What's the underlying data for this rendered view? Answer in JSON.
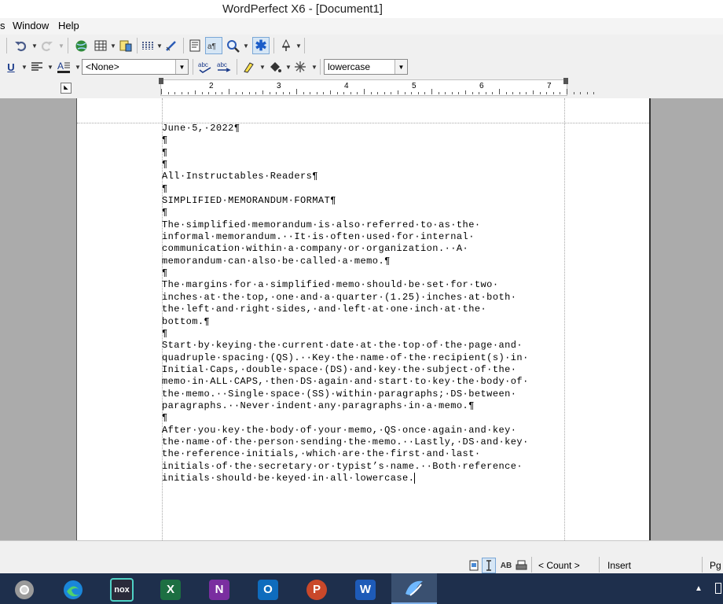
{
  "window": {
    "title": "WordPerfect X6 - [Document1]"
  },
  "menu": [
    {
      "label": "s",
      "x": 0
    },
    {
      "label": "Window",
      "x": 16
    },
    {
      "label": "Help",
      "x": 74
    }
  ],
  "toolbar": {
    "style_combo": "<None>",
    "case_combo": "lowercase"
  },
  "ruler": {
    "numbers": [
      "2",
      "3",
      "4",
      "5",
      "6",
      "7"
    ]
  },
  "document": {
    "lines": [
      "June·5,·2022¶",
      "¶",
      "¶",
      "¶",
      "All·Instructables·Readers¶",
      "¶",
      "SIMPLIFIED·MEMORANDUM·FORMAT¶",
      "¶",
      "The·simplified·memorandum·is·also·referred·to·as·the·",
      "informal·memorandum.··It·is·often·used·for·internal·",
      "communication·within·a·company·or·organization.··A·",
      "memorandum·can·also·be·called·a·memo.¶",
      "¶",
      "The·margins·for·a·simplified·memo·should·be·set·for·two·",
      "inches·at·the·top,·one·and·a·quarter·(1.25)·inches·at·both·",
      "the·left·and·right·sides,·and·left·at·one·inch·at·the·",
      "bottom.¶",
      "¶",
      "Start·by·keying·the·current·date·at·the·top·of·the·page·and·",
      "quadruple·spacing·(QS).··Key·the·name·of·the·recipient(s)·in·",
      "Initial·Caps,·double·space·(DS)·and·key·the·subject·of·the·",
      "memo·in·ALL·CAPS,·then·DS·again·and·start·to·key·the·body·of·",
      "the·memo.··Single·space·(SS)·within·paragraphs;·DS·between·",
      "paragraphs.··Never·indent·any·paragraphs·in·a·memo.¶",
      "¶",
      "After·you·key·the·body·of·your·memo,·QS·once·again·and·key·",
      "the·name·of·the·person·sending·the·memo.··Lastly,·DS·and·key·",
      "the·reference·initials,·which·are·the·first·and·last·",
      "initials·of·the·secretary·or·typist’s·name.··Both·reference·",
      "initials·should·be·keyed·in·all·lowercase."
    ]
  },
  "status": {
    "count": "< Count >",
    "mode": "Insert",
    "pg": "Pg"
  },
  "colors": {
    "taskbar": "#1e2f4c",
    "titlebar": "#ffffff",
    "page": "#ffffff",
    "workspace": "#ababab"
  },
  "taskbar": {
    "apps": [
      {
        "name": "chrome-icon"
      },
      {
        "name": "edge-icon"
      },
      {
        "name": "nox-icon",
        "label": "nox"
      },
      {
        "name": "excel-icon",
        "label": "X"
      },
      {
        "name": "onenote-icon",
        "label": "N"
      },
      {
        "name": "outlook-icon",
        "label": "O"
      },
      {
        "name": "powerpoint-icon",
        "label": "P"
      },
      {
        "name": "word-icon",
        "label": "W"
      },
      {
        "name": "wordperfect-icon"
      }
    ]
  }
}
